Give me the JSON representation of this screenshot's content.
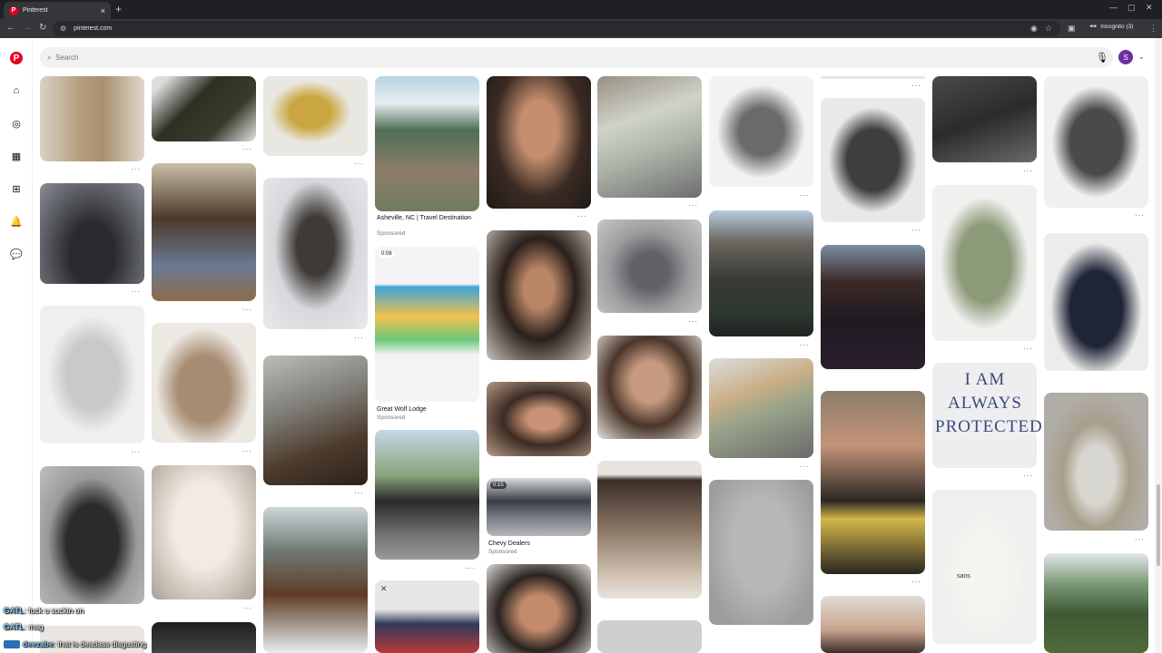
{
  "browser": {
    "tab_title": "Pinterest",
    "url": "pinterest.com",
    "incognito_label": "Incognito (3)",
    "new_tab": "+",
    "close_tab": "×"
  },
  "search": {
    "placeholder": "Search"
  },
  "account": {
    "avatar_letter": "S"
  },
  "sidebar": {
    "items": [
      {
        "name": "home-icon",
        "glyph": "⌂"
      },
      {
        "name": "explore-icon",
        "glyph": "◎"
      },
      {
        "name": "boards-icon",
        "glyph": "▦"
      },
      {
        "name": "create-icon",
        "glyph": "⊞"
      },
      {
        "name": "notifications-icon",
        "glyph": "🔔"
      },
      {
        "name": "messages-icon",
        "glyph": "💬"
      }
    ]
  },
  "pins": {
    "asheville_title": "Asheville, NC | Travel Destination",
    "asheville_sub": "Sponsored",
    "video_time": "0:06",
    "greatwolf_title": "Great Wolf Lodge",
    "greatwolf_sub": "Sponsored",
    "chevy_title": "Chevy Dealers",
    "chevy_sub": "Sponsored",
    "chevy_badge": "0:15",
    "quote_text": "I AM ALWAYS PROTECTED",
    "sans_label": "sans",
    "more": "···"
  },
  "chat": [
    {
      "user": "GATL",
      "text": ": fuck u suckin on"
    },
    {
      "user": "GATL",
      "text": ": mag"
    },
    {
      "user": "deezabe",
      "text": ": that is deadass disgusting"
    }
  ]
}
